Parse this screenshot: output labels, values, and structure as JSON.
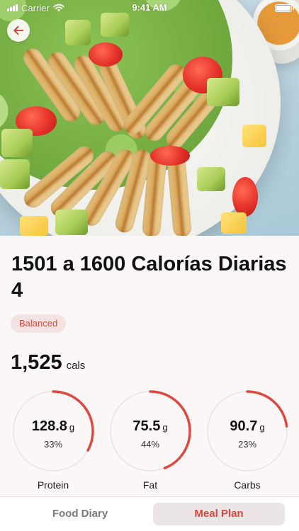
{
  "status_bar": {
    "carrier": "Carrier",
    "time": "9:41 AM"
  },
  "hero": {
    "back_icon": "arrow-left-icon",
    "accent_color": "#d9473f"
  },
  "recipe": {
    "title": "1501 a 1600 Calorías Diarias 4",
    "tag": "Balanced",
    "calories_value": "1,525",
    "calories_unit": "cals"
  },
  "macros": [
    {
      "label": "Protein",
      "amount": "128.8",
      "unit": "g",
      "percent_text": "33%",
      "percent": 33
    },
    {
      "label": "Fat",
      "amount": "75.5",
      "unit": "g",
      "percent_text": "44%",
      "percent": 44
    },
    {
      "label": "Carbs",
      "amount": "90.7",
      "unit": "g",
      "percent_text": "23%",
      "percent": 23
    }
  ],
  "ring_colors": {
    "track": "#e8e3e2",
    "progress": "#e0473e"
  },
  "tabs": [
    {
      "label": "Food Diary",
      "active": false
    },
    {
      "label": "Meal Plan",
      "active": true
    }
  ]
}
